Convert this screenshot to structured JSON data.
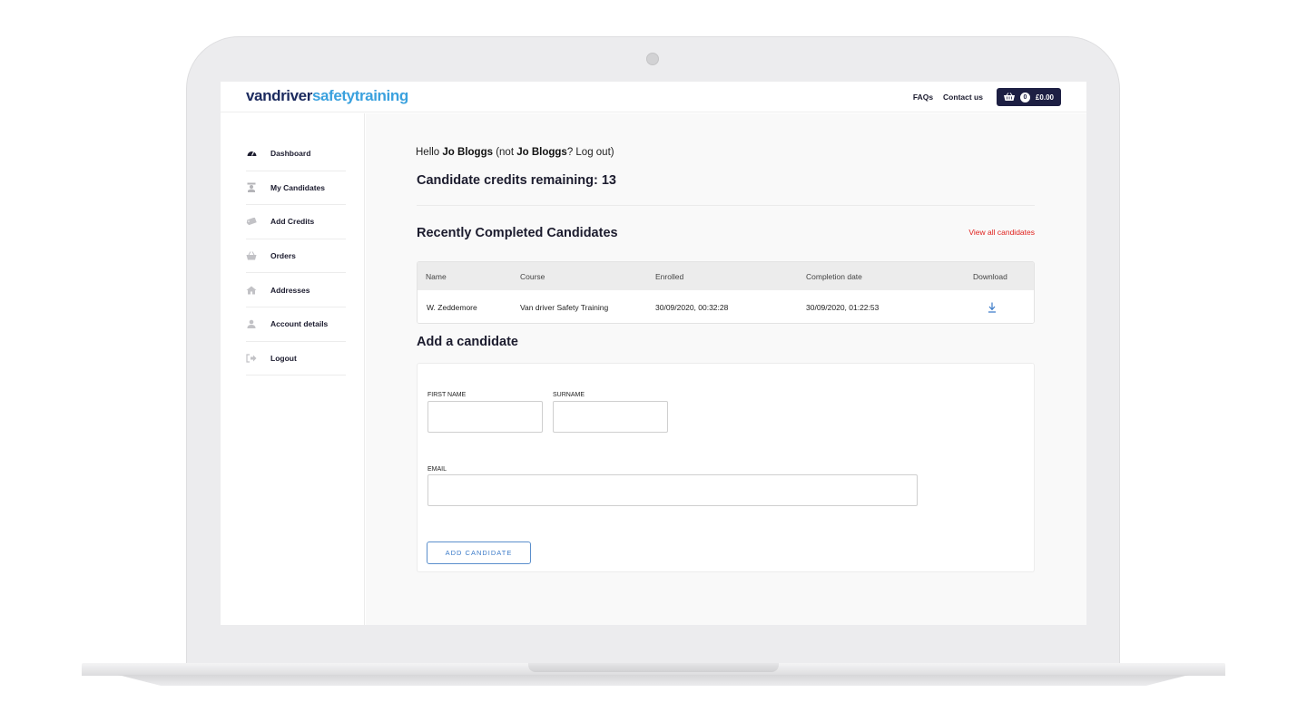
{
  "header": {
    "logo": {
      "part1": "vandriver",
      "part2": "safety",
      "part3": "training"
    },
    "nav": [
      {
        "label": "FAQs"
      },
      {
        "label": "Contact us"
      }
    ],
    "cart": {
      "count": "0",
      "total": "£0.00"
    }
  },
  "sidebar": {
    "items": [
      {
        "label": "Dashboard",
        "icon": "dashboard-gauge-icon"
      },
      {
        "label": "My Candidates",
        "icon": "candidate-icon"
      },
      {
        "label": "Add Credits",
        "icon": "ticket-icon"
      },
      {
        "label": "Orders",
        "icon": "basket-icon"
      },
      {
        "label": "Addresses",
        "icon": "home-icon"
      },
      {
        "label": "Account details",
        "icon": "user-icon"
      },
      {
        "label": "Logout",
        "icon": "logout-icon"
      }
    ]
  },
  "main": {
    "hello": {
      "prefix": "Hello ",
      "name": "Jo Bloggs",
      "mid": " (not ",
      "name2": "Jo Bloggs",
      "suffix": "? Log out)"
    },
    "credits_text": "Candidate credits remaining: 13",
    "recent_title": "Recently Completed Candidates",
    "view_all": "View all candidates",
    "table": {
      "headers": [
        "Name",
        "Course",
        "Enrolled",
        "Completion date",
        "Download"
      ],
      "rows": [
        {
          "name": "W. Zeddemore",
          "course": "Van driver Safety Training",
          "enrolled": "30/09/2020, 00:32:28",
          "completion": "30/09/2020, 01:22:53"
        }
      ]
    },
    "add_title": "Add a candidate",
    "form": {
      "first_name_label": "FIRST NAME",
      "surname_label": "SURNAME",
      "email_label": "EMAIL",
      "first_name_value": "",
      "surname_value": "",
      "email_value": "",
      "submit_label": "ADD CANDIDATE"
    }
  },
  "colors": {
    "brand_dark": "#1b2a5e",
    "brand_light": "#3aa1de",
    "link_red": "#e0221e",
    "button_blue": "#3d7cc9",
    "cart_bg": "#1d1f43"
  }
}
